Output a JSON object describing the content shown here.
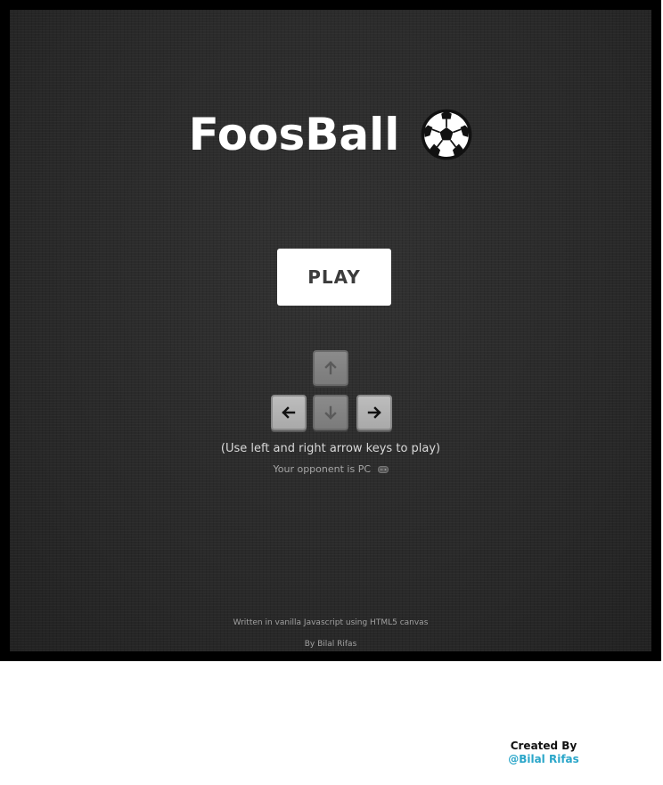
{
  "game": {
    "title": "FoosBall",
    "play_label": "PLAY",
    "instructions": "(Use left and right arrow keys to play)",
    "opponent_text": "Your opponent is PC",
    "footer_tech": "Written in vanilla Javascript using HTML5 canvas",
    "footer_author": "By Bilal Rifas"
  },
  "controls": {
    "icons": [
      "arrow-up-key",
      "arrow-left-key",
      "arrow-down-key",
      "arrow-right-key"
    ],
    "active_keys": [
      "left",
      "right"
    ],
    "disabled_keys": [
      "up",
      "down"
    ]
  },
  "credit": {
    "label": "Created By",
    "link_text": "@Bilal Rifas"
  },
  "colors": {
    "frame": "#000000",
    "background": "#2b2b2b",
    "title": "#ffffff",
    "button_bg": "#ffffff",
    "button_text": "#3c3c3c",
    "credit_link": "#2aa6c9"
  }
}
